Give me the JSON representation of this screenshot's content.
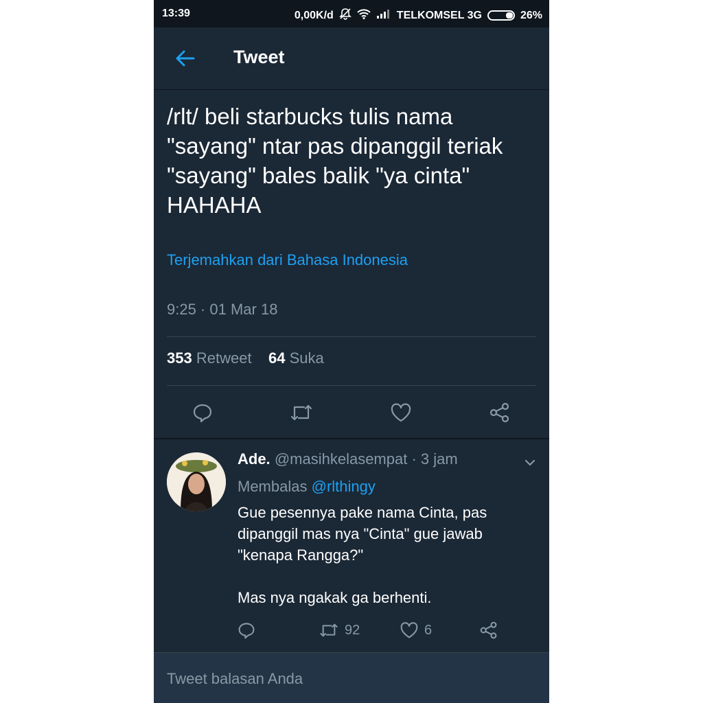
{
  "status_bar": {
    "time": "13:39",
    "speed": "0,00K/d",
    "carrier": "TELKOMSEL 3G",
    "battery": "26%"
  },
  "header": {
    "title": "Tweet"
  },
  "tweet": {
    "text": "/rlt/ beli starbucks tulis nama\n\"sayang\" ntar pas dipanggil teriak\n\"sayang\"  bales balik \"ya cinta\"\nHAHAHA",
    "translate_link": "Terjemahkan dari Bahasa Indonesia",
    "timestamp": "9:25 · 01 Mar 18",
    "retweet_count": "353",
    "retweet_label": "Retweet",
    "like_count": "64",
    "like_label": "Suka"
  },
  "reply": {
    "name": "Ade.",
    "handle": "@masihkelasempat",
    "time": "· 3 jam",
    "replying_label": "Membalas",
    "replying_to": "@rlthingy",
    "text": "Gue pesennya pake nama Cinta, pas\ndipanggil mas nya \"Cinta\" gue jawab\n\"kenapa Rangga?\"\n\nMas nya ngakak ga berhenti.",
    "retweet_count": "92",
    "like_count": "6"
  },
  "composer": {
    "placeholder": "Tweet balasan Anda"
  },
  "colors": {
    "background": "#1b2836",
    "accent": "#1da1f2",
    "muted": "#8899a6"
  },
  "icons": [
    "back-arrow-icon",
    "reply-icon",
    "retweet-icon",
    "like-icon",
    "share-icon",
    "chevron-down-icon",
    "mute-icon",
    "wifi-icon",
    "signal-icon",
    "battery-icon"
  ]
}
